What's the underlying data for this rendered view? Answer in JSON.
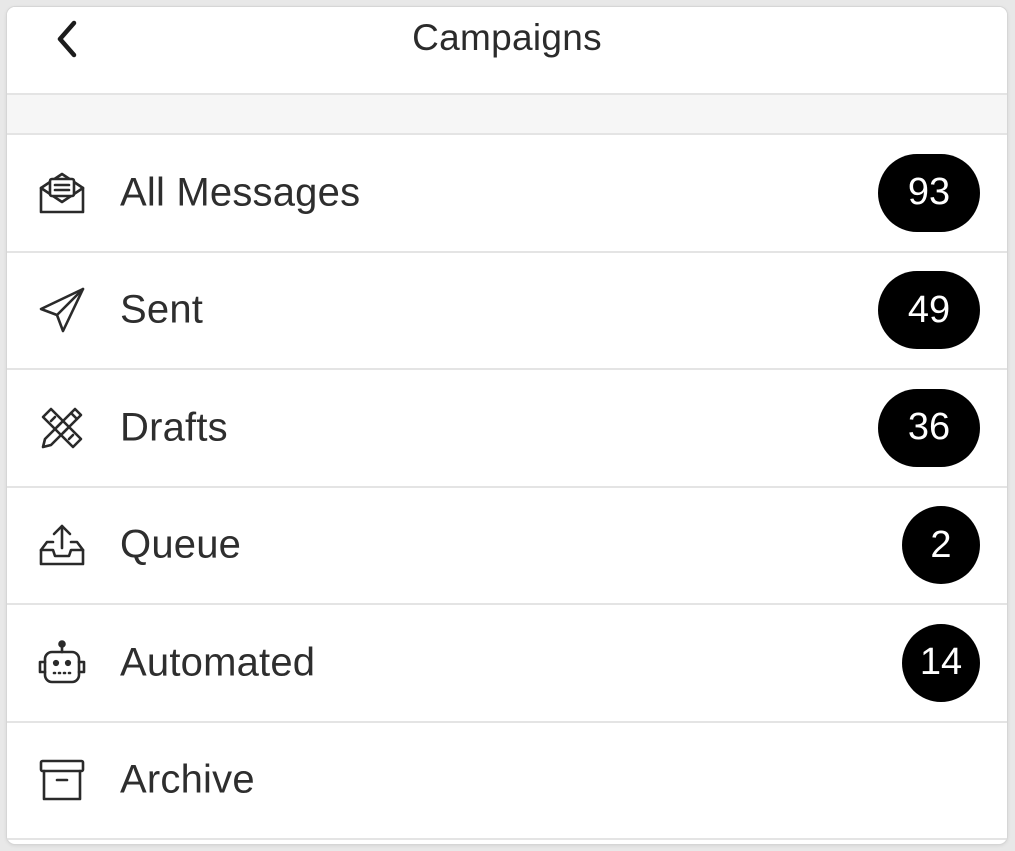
{
  "header": {
    "title": "Campaigns"
  },
  "items": [
    {
      "label": "All Messages",
      "icon": "envelope-open-icon",
      "count": "93"
    },
    {
      "label": "Sent",
      "icon": "paper-plane-icon",
      "count": "49"
    },
    {
      "label": "Drafts",
      "icon": "pencil-ruler-icon",
      "count": "36"
    },
    {
      "label": "Queue",
      "icon": "tray-upload-icon",
      "count": "2"
    },
    {
      "label": "Automated",
      "icon": "robot-icon",
      "count": "14"
    },
    {
      "label": "Archive",
      "icon": "archive-box-icon",
      "count": ""
    }
  ],
  "colors": {
    "badge_bg": "#000000",
    "badge_text": "#ffffff",
    "text": "#2e2e2e",
    "divider": "#e4e4e4"
  }
}
